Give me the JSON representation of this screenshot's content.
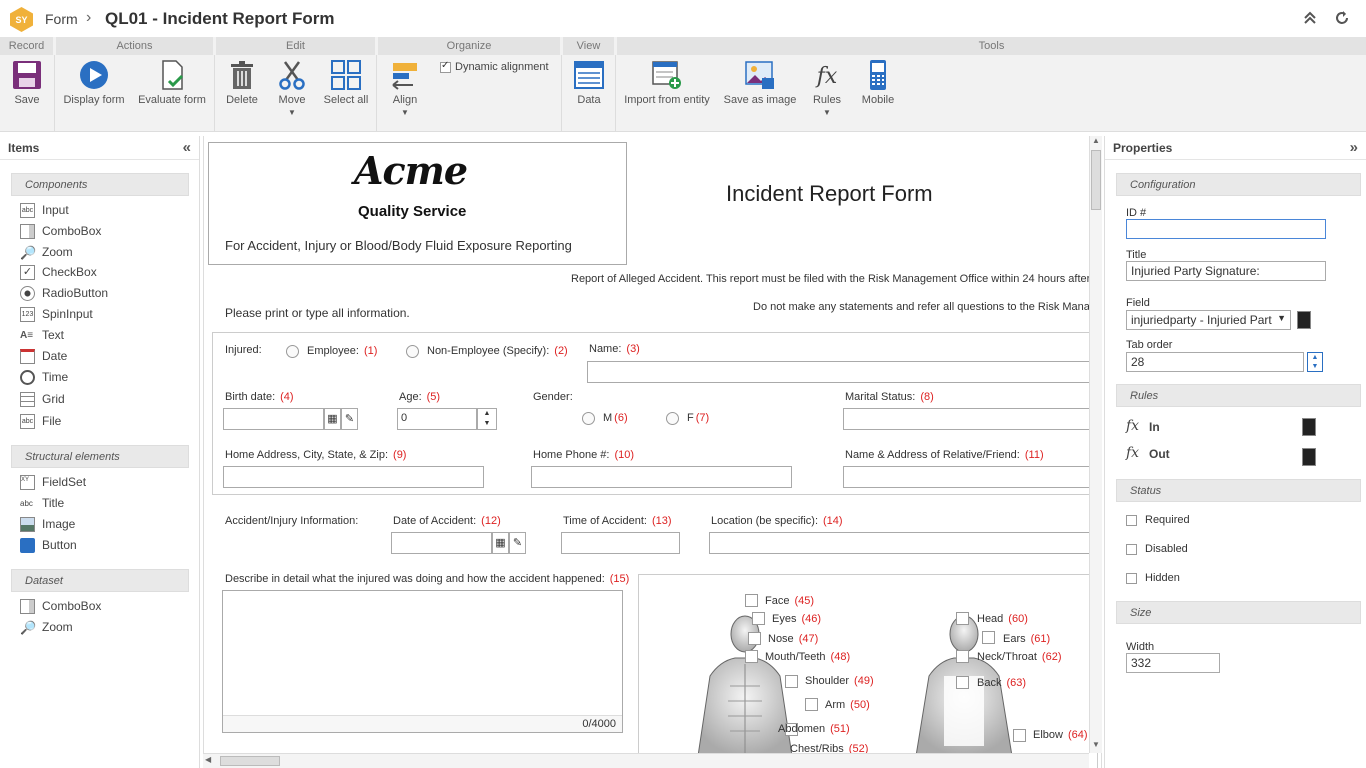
{
  "breadcrumb": {
    "root": "Form",
    "separator": "›",
    "current": "QL01 - Incident Report Form"
  },
  "ribbon": {
    "groups": [
      "Record",
      "Actions",
      "Edit",
      "Organize",
      "View",
      "Tools"
    ],
    "buttons": {
      "save": "Save",
      "display_form": "Display form",
      "evaluate_form": "Evaluate form",
      "delete": "Delete",
      "move": "Move",
      "select_all": "Select all",
      "align": "Align",
      "dynamic_alignment": "Dynamic alignment",
      "data": "Data",
      "import_entity": "Import from entity",
      "save_image": "Save as image",
      "rules": "Rules",
      "mobile": "Mobile"
    }
  },
  "items_panel": {
    "title": "Items",
    "components_title": "Components",
    "components": [
      "Input",
      "ComboBox",
      "Zoom",
      "CheckBox",
      "RadioButton",
      "SpinInput",
      "Text",
      "Date",
      "Time",
      "Grid",
      "File"
    ],
    "structural_title": "Structural elements",
    "structural": [
      "FieldSet",
      "Title",
      "Image",
      "Button"
    ],
    "dataset_title": "Dataset",
    "dataset": [
      "ComboBox",
      "Zoom"
    ]
  },
  "form": {
    "logo_word": "Acme",
    "logo_tag": "Quality Service",
    "logo_sub": "For Accident, Injury or Blood/Body Fluid Exposure Reporting",
    "title": "Incident Report Form",
    "notice1": "Report of Alleged Accident. This report must be filed with the Risk Management Office within 24 hours after",
    "notice2": "Do not make any statements and refer all questions to the Risk Manage",
    "print_note": "Please print or type all information.",
    "injured": "Injured:",
    "employee": "Employee:",
    "employee_n": "(1)",
    "non_employee": "Non-Employee (Specify):",
    "non_employee_n": "(2)",
    "name": "Name:",
    "name_n": "(3)",
    "birth": "Birth date:",
    "birth_n": "(4)",
    "age": "Age:",
    "age_n": "(5)",
    "age_value": "0",
    "gender": "Gender:",
    "male": "M",
    "male_n": "(6)",
    "female": "F",
    "female_n": "(7)",
    "marital": "Marital Status:",
    "marital_n": "(8)",
    "address": "Home Address, City, State, & Zip:",
    "address_n": "(9)",
    "phone": "Home Phone #:",
    "phone_n": "(10)",
    "relative": "Name & Address of Relative/Friend:",
    "relative_n": "(11)",
    "accident_info": "Accident/Injury Information:",
    "acc_date": "Date of Accident:",
    "acc_date_n": "(12)",
    "acc_time": "Time of Accident:",
    "acc_time_n": "(13)",
    "location": "Location (be specific):",
    "location_n": "(14)",
    "describe": "Describe in detail what the injured was doing and how the accident happened:",
    "describe_n": "(15)",
    "counter": "0/4000",
    "front_parts": [
      {
        "label": "Face",
        "n": "(45)"
      },
      {
        "label": "Eyes",
        "n": "(46)"
      },
      {
        "label": "Nose",
        "n": "(47)"
      },
      {
        "label": "Mouth/Teeth",
        "n": "(48)"
      },
      {
        "label": "Shoulder",
        "n": "(49)"
      },
      {
        "label": "Arm",
        "n": "(50)"
      },
      {
        "label": "Abdomen",
        "n": "(51)"
      },
      {
        "label": "Chest/Ribs",
        "n": "(52)"
      }
    ],
    "back_parts": [
      {
        "label": "Head",
        "n": "(60)"
      },
      {
        "label": "Ears",
        "n": "(61)"
      },
      {
        "label": "Neck/Throat",
        "n": "(62)"
      },
      {
        "label": "Back",
        "n": "(63)"
      },
      {
        "label": "Elbow",
        "n": "(64)"
      }
    ]
  },
  "properties": {
    "title": "Properties",
    "configuration": "Configuration",
    "id_label": "ID #",
    "id_value": "",
    "title_label": "Title",
    "title_value": "Injuried Party Signature:",
    "field_label": "Field",
    "field_value": "injuriedparty - Injuried Part",
    "tab_label": "Tab order",
    "tab_value": "28",
    "rules": "Rules",
    "rule_in": "In",
    "rule_out": "Out",
    "status": "Status",
    "required": "Required",
    "disabled": "Disabled",
    "hidden": "Hidden",
    "size": "Size",
    "width_label": "Width",
    "width_value": "332"
  }
}
